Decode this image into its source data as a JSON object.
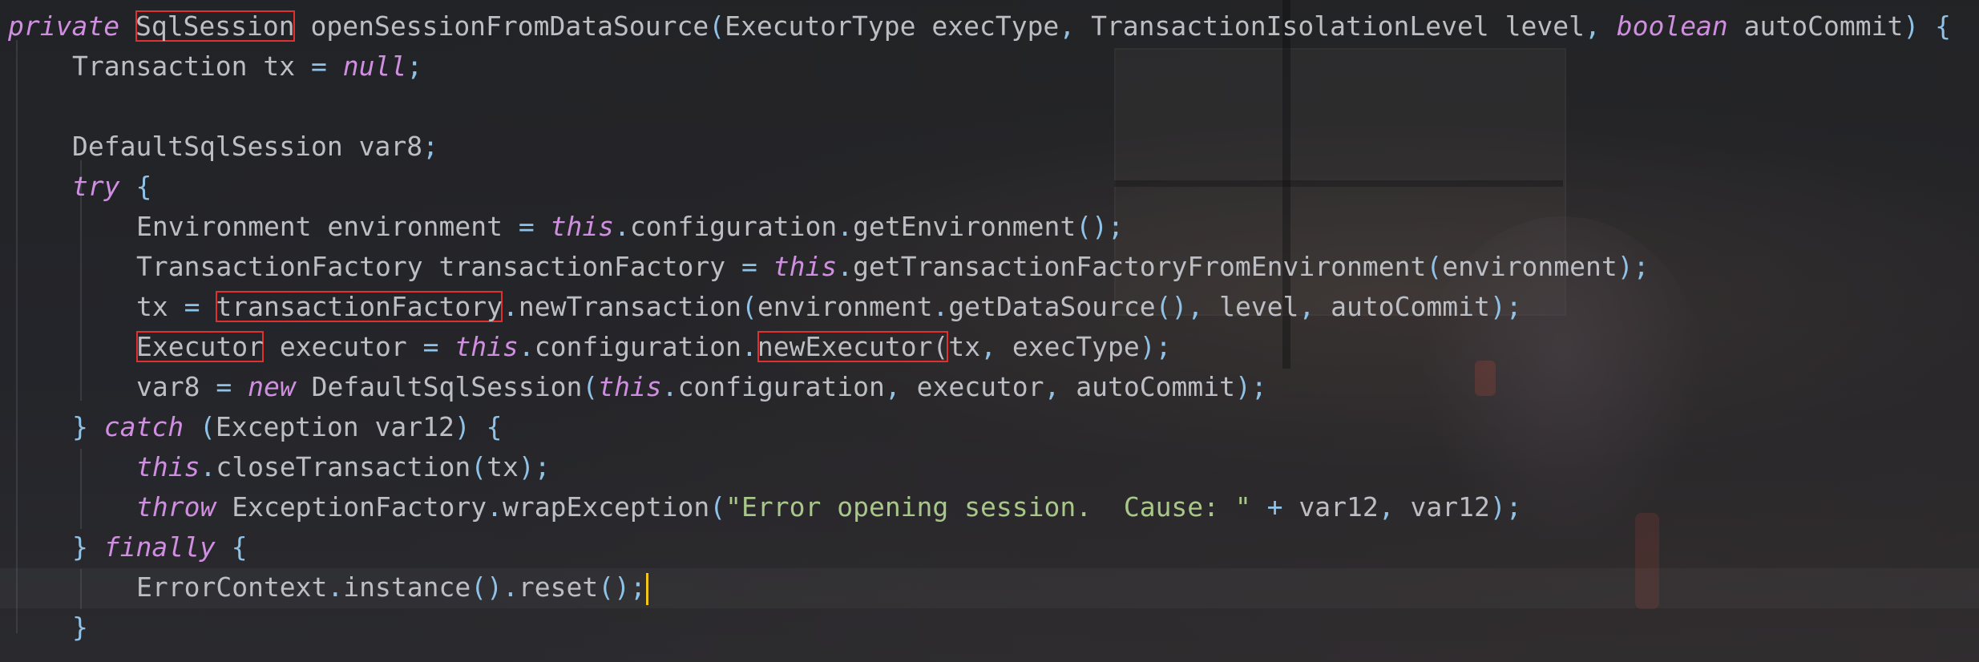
{
  "editor": {
    "language": "java",
    "highlight_color": "#e0312f",
    "keyword_color": "#cf8ee0",
    "punctuation_color": "#8fc2e6",
    "string_color": "#a8c88a",
    "text_color": "#bcbec4",
    "caret_color": "#f5c518",
    "lines": [
      {
        "tokens": [
          {
            "t": "private",
            "c": "kw"
          },
          {
            "t": " ",
            "c": "tx"
          },
          {
            "t": "SqlSession",
            "c": "tx",
            "hl": true
          },
          {
            "t": " openSessionFromDataSource",
            "c": "tx"
          },
          {
            "t": "(",
            "c": "pn"
          },
          {
            "t": "ExecutorType execType",
            "c": "tx"
          },
          {
            "t": ", ",
            "c": "pn"
          },
          {
            "t": "TransactionIsolationLevel level",
            "c": "tx"
          },
          {
            "t": ", ",
            "c": "pn"
          },
          {
            "t": "boolean",
            "c": "kw"
          },
          {
            "t": " autoCommit",
            "c": "tx"
          },
          {
            "t": ") {",
            "c": "pn"
          }
        ]
      },
      {
        "tokens": [
          {
            "t": "Transaction tx ",
            "c": "tx"
          },
          {
            "t": "=",
            "c": "pn"
          },
          {
            "t": " ",
            "c": "tx"
          },
          {
            "t": "null",
            "c": "kw"
          },
          {
            "t": ";",
            "c": "pn"
          }
        ]
      },
      {
        "tokens": []
      },
      {
        "tokens": [
          {
            "t": "DefaultSqlSession var8",
            "c": "tx"
          },
          {
            "t": ";",
            "c": "pn"
          }
        ]
      },
      {
        "tokens": [
          {
            "t": "try",
            "c": "kw"
          },
          {
            "t": " {",
            "c": "pn"
          }
        ]
      },
      {
        "tokens": [
          {
            "t": "Environment environment ",
            "c": "tx"
          },
          {
            "t": "=",
            "c": "pn"
          },
          {
            "t": " ",
            "c": "tx"
          },
          {
            "t": "this",
            "c": "kw"
          },
          {
            "t": ".",
            "c": "pn"
          },
          {
            "t": "configuration",
            "c": "tx"
          },
          {
            "t": ".",
            "c": "pn"
          },
          {
            "t": "getEnvironment",
            "c": "tx"
          },
          {
            "t": "();",
            "c": "pn"
          }
        ]
      },
      {
        "tokens": [
          {
            "t": "TransactionFactory transactionFactory ",
            "c": "tx"
          },
          {
            "t": "=",
            "c": "pn"
          },
          {
            "t": " ",
            "c": "tx"
          },
          {
            "t": "this",
            "c": "kw"
          },
          {
            "t": ".",
            "c": "pn"
          },
          {
            "t": "getTransactionFactoryFromEnvironment",
            "c": "tx"
          },
          {
            "t": "(",
            "c": "pn"
          },
          {
            "t": "environment",
            "c": "tx"
          },
          {
            "t": ");",
            "c": "pn"
          }
        ]
      },
      {
        "tokens": [
          {
            "t": "tx ",
            "c": "tx"
          },
          {
            "t": "=",
            "c": "pn"
          },
          {
            "t": " ",
            "c": "tx"
          },
          {
            "t": "transactionFactory",
            "c": "tx",
            "hl": true
          },
          {
            "t": ".",
            "c": "pn"
          },
          {
            "t": "newTransaction",
            "c": "tx"
          },
          {
            "t": "(",
            "c": "pn"
          },
          {
            "t": "environment",
            "c": "tx"
          },
          {
            "t": ".",
            "c": "pn"
          },
          {
            "t": "getDataSource",
            "c": "tx"
          },
          {
            "t": "(), ",
            "c": "pn"
          },
          {
            "t": "level",
            "c": "tx"
          },
          {
            "t": ", ",
            "c": "pn"
          },
          {
            "t": "autoCommit",
            "c": "tx"
          },
          {
            "t": ");",
            "c": "pn"
          }
        ]
      },
      {
        "tokens": [
          {
            "t": "Executor",
            "c": "tx",
            "hl": true
          },
          {
            "t": " executor ",
            "c": "tx"
          },
          {
            "t": "=",
            "c": "pn"
          },
          {
            "t": " ",
            "c": "tx"
          },
          {
            "t": "this",
            "c": "kw"
          },
          {
            "t": ".",
            "c": "pn"
          },
          {
            "t": "configuration",
            "c": "tx"
          },
          {
            "t": ".",
            "c": "pn"
          },
          {
            "t": "newExecutor(",
            "c": "tx",
            "hl": true
          },
          {
            "t": "tx",
            "c": "tx"
          },
          {
            "t": ", ",
            "c": "pn"
          },
          {
            "t": "execType",
            "c": "tx"
          },
          {
            "t": ");",
            "c": "pn"
          }
        ]
      },
      {
        "tokens": [
          {
            "t": "var8 ",
            "c": "tx"
          },
          {
            "t": "=",
            "c": "pn"
          },
          {
            "t": " ",
            "c": "tx"
          },
          {
            "t": "new",
            "c": "kw"
          },
          {
            "t": " DefaultSqlSession",
            "c": "tx"
          },
          {
            "t": "(",
            "c": "pn"
          },
          {
            "t": "this",
            "c": "kw"
          },
          {
            "t": ".",
            "c": "pn"
          },
          {
            "t": "configuration",
            "c": "tx"
          },
          {
            "t": ", ",
            "c": "pn"
          },
          {
            "t": "executor",
            "c": "tx"
          },
          {
            "t": ", ",
            "c": "pn"
          },
          {
            "t": "autoCommit",
            "c": "tx"
          },
          {
            "t": ");",
            "c": "pn"
          }
        ]
      },
      {
        "tokens": [
          {
            "t": "} ",
            "c": "pn"
          },
          {
            "t": "catch",
            "c": "kw"
          },
          {
            "t": " (",
            "c": "pn"
          },
          {
            "t": "Exception var12",
            "c": "tx"
          },
          {
            "t": ") {",
            "c": "pn"
          }
        ]
      },
      {
        "tokens": [
          {
            "t": "this",
            "c": "kw"
          },
          {
            "t": ".",
            "c": "pn"
          },
          {
            "t": "closeTransaction",
            "c": "tx"
          },
          {
            "t": "(",
            "c": "pn"
          },
          {
            "t": "tx",
            "c": "tx"
          },
          {
            "t": ");",
            "c": "pn"
          }
        ]
      },
      {
        "tokens": [
          {
            "t": "throw",
            "c": "kw"
          },
          {
            "t": " ExceptionFactory",
            "c": "tx"
          },
          {
            "t": ".",
            "c": "pn"
          },
          {
            "t": "wrapException",
            "c": "tx"
          },
          {
            "t": "(",
            "c": "pn"
          },
          {
            "t": "\"Error opening session.  Cause: \"",
            "c": "st"
          },
          {
            "t": " + ",
            "c": "pn"
          },
          {
            "t": "var12",
            "c": "tx"
          },
          {
            "t": ", ",
            "c": "pn"
          },
          {
            "t": "var12",
            "c": "tx"
          },
          {
            "t": ");",
            "c": "pn"
          }
        ]
      },
      {
        "tokens": [
          {
            "t": "} ",
            "c": "pn"
          },
          {
            "t": "finally",
            "c": "kw"
          },
          {
            "t": " {",
            "c": "pn"
          }
        ]
      },
      {
        "tokens": [
          {
            "t": "ErrorContext",
            "c": "tx"
          },
          {
            "t": ".",
            "c": "pn"
          },
          {
            "t": "instance",
            "c": "tx"
          },
          {
            "t": "().",
            "c": "pn"
          },
          {
            "t": "reset",
            "c": "tx"
          },
          {
            "t": "();",
            "c": "pn"
          }
        ]
      },
      {
        "tokens": [
          {
            "t": "}",
            "c": "pn"
          }
        ]
      }
    ]
  }
}
